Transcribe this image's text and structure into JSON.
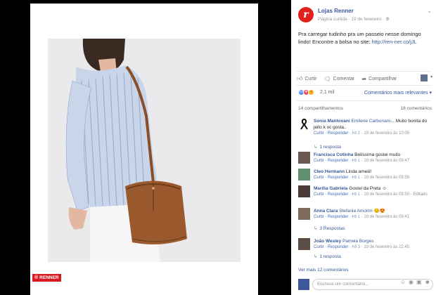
{
  "photo": {
    "brand_tag": "RENNER"
  },
  "post": {
    "page_name": "Lojas Renner",
    "meta": "Página curtida · 19 de fevereiro · ",
    "avatar_letter": "r",
    "text": "Pra carregar tudinho pra um passeio nesse domingo lindo! Encontre a bolsa no site: ",
    "link": "http://ren-ner.co/jJL",
    "options_glyph": "⌄"
  },
  "actions": {
    "like": "Curtir",
    "comment": "Comentar",
    "share": "Compartilhar"
  },
  "reactions": {
    "count": "2,1 mil",
    "sort_label": "Comentários mais relevantes ▾"
  },
  "counts": {
    "shares": "14 compartilhamentos",
    "comments": "18 comentários"
  },
  "comments": [
    {
      "author": "Sonia Mantovani",
      "tagged": "Emilene Carbonaro",
      "text": "... Muito bonita do jeito k vc gosta..",
      "meta_actions": "Curtir · Responder · ",
      "likes": "2",
      "date": " · 19 de fevereiro às 10:05",
      "replies": "1 resposta"
    },
    {
      "author": "Francisca Cotinha",
      "tagged": "",
      "text": "Belíssima gostei muito",
      "meta_actions": "Curtir · Responder · ",
      "likes": "1",
      "date": " · 19 de fevereiro às 09:47",
      "replies": ""
    },
    {
      "author": "Cleo Hermann",
      "tagged": "",
      "text": "Linda ameiii!",
      "meta_actions": "Curtir · Responder · ",
      "likes": "1",
      "date": " · 19 de fevereiro às 09:59",
      "replies": ""
    },
    {
      "author": "Marilia Gabriela",
      "tagged": "",
      "text": "Gostei da Preta ☺",
      "meta_actions": "Curtir · Responder · ",
      "likes": "1",
      "date": " · 19 de fevereiro às 09:50 · Editado",
      "replies": ""
    },
    {
      "author": "Anna Clara",
      "tagged": "Stefania Amorim",
      "text": "😊😍",
      "meta_actions": "Curtir · Responder · ",
      "likes": "1",
      "date": " · 19 de fevereiro às 09:41",
      "replies": "3 Respostas"
    },
    {
      "author": "João Wesley",
      "tagged": "Pamela Borges",
      "text": "",
      "meta_actions": "Curtir · Responder · ",
      "likes": "3",
      "date": " · 19 de fevereiro às 22:45",
      "replies": "1 resposta"
    }
  ],
  "more_comments": "Ver mais 12 comentários",
  "write_placeholder": "Escreva um comentário...",
  "colors": {
    "brand_red": "#e0201b",
    "link_blue": "#365899",
    "meta_gray": "#90949c",
    "bag_brown": "#9a5a2e"
  }
}
